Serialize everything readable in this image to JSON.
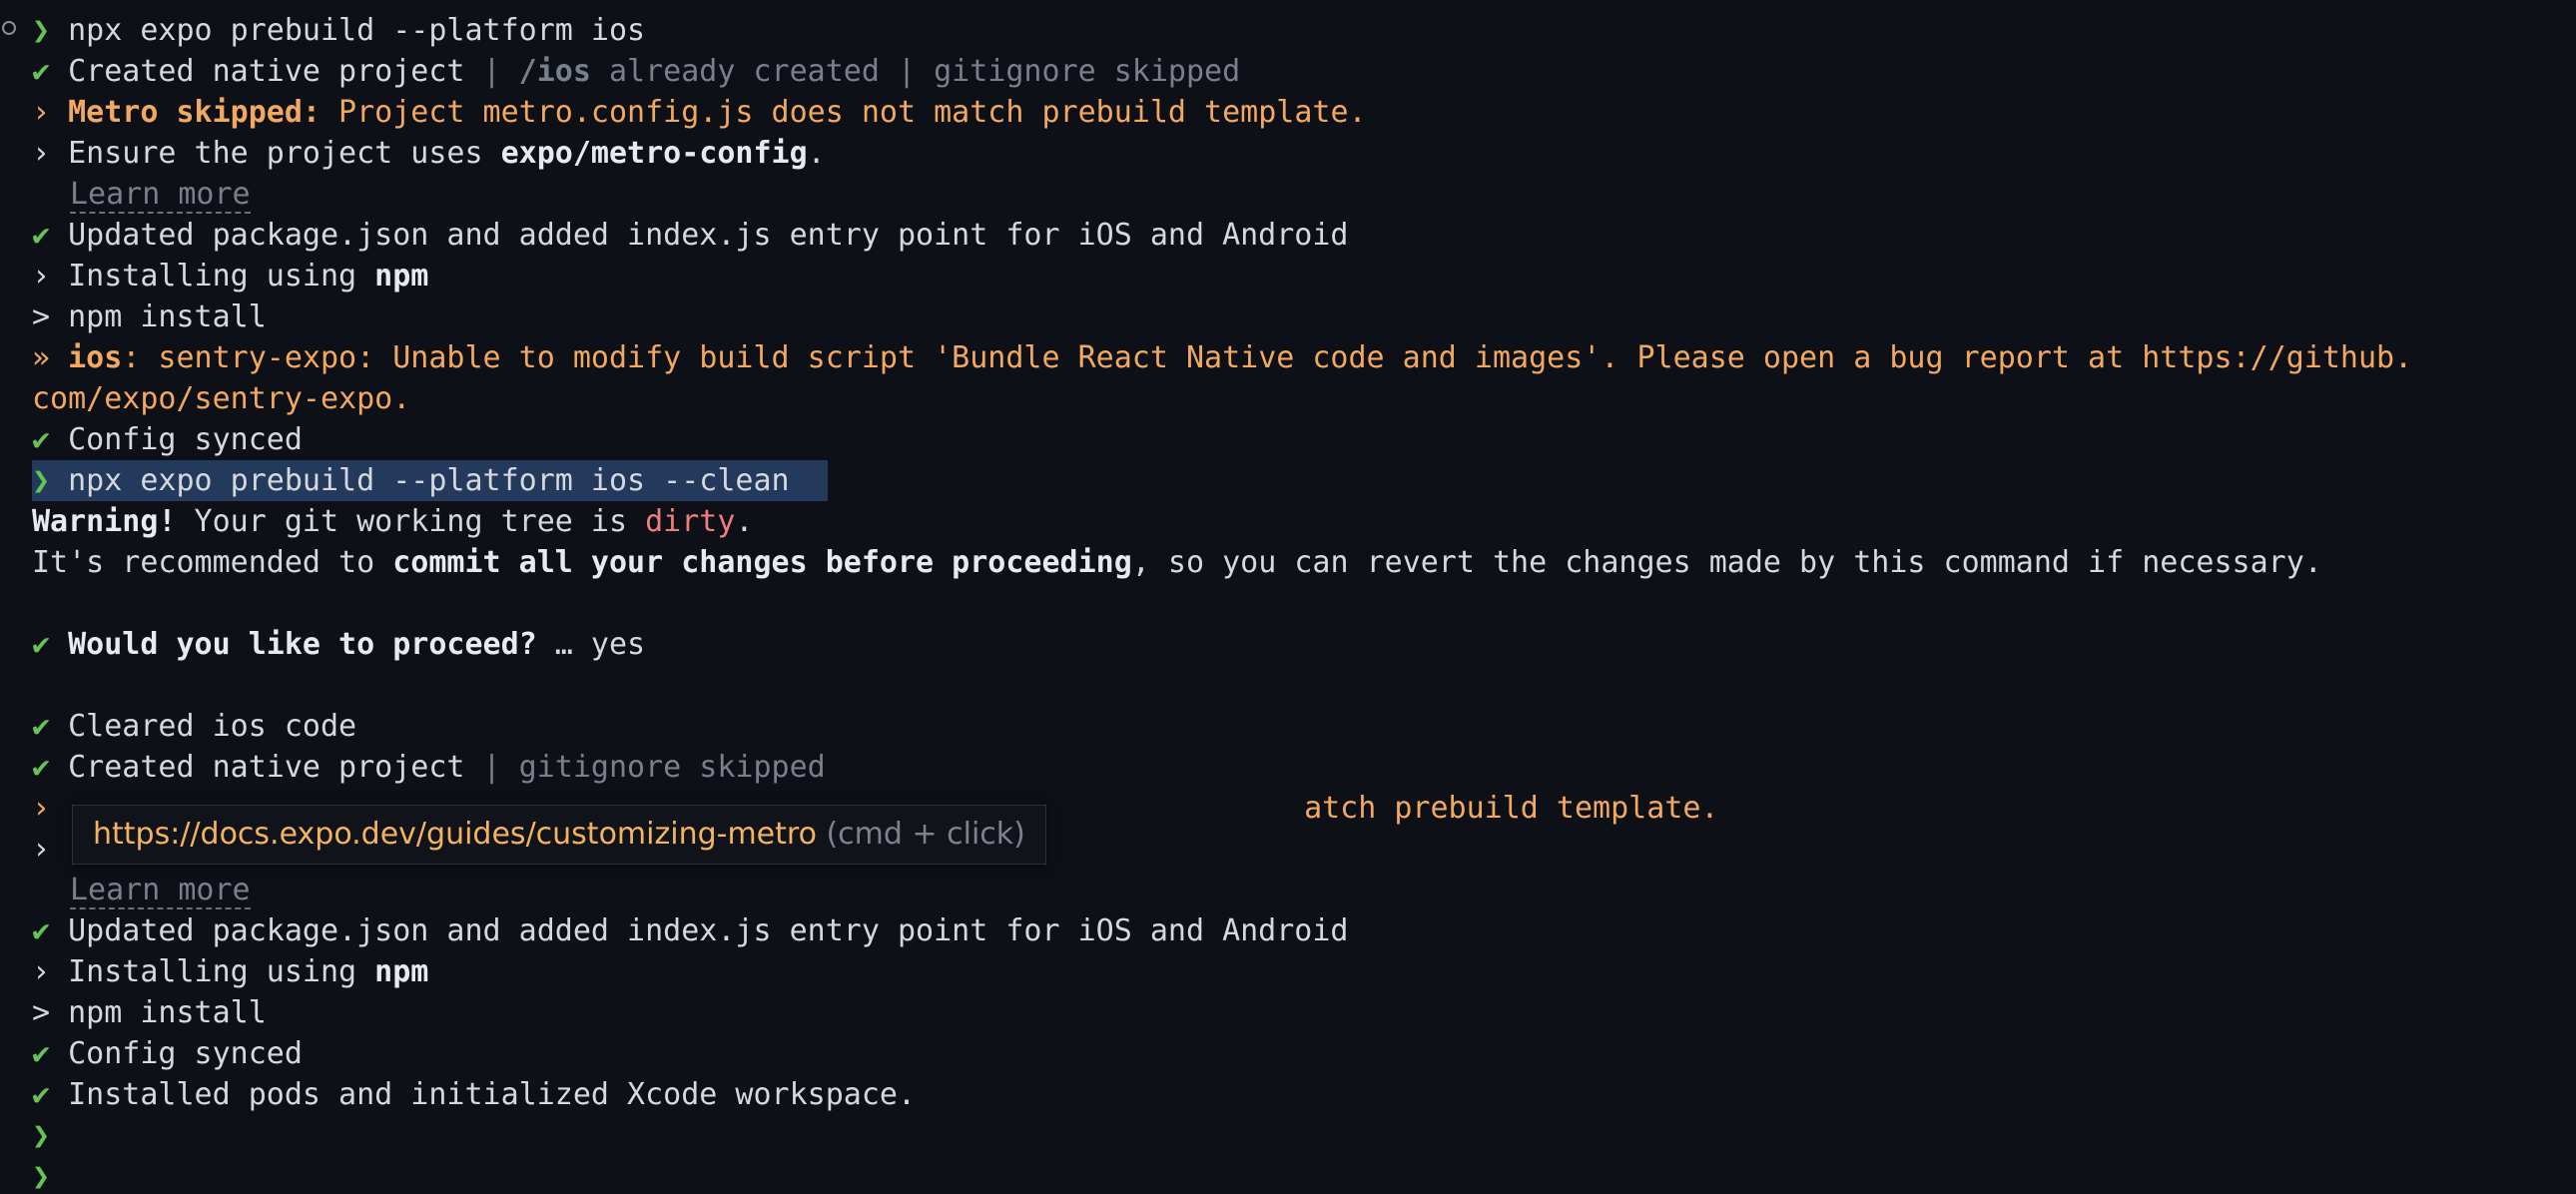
{
  "symbols": {
    "prompt": "❯",
    "check": "✔",
    "info": "›",
    "cmd": ">",
    "warn": "»"
  },
  "session1": {
    "command": "npx expo prebuild --platform ios",
    "created_a": "Created native project",
    "sep": " | ",
    "ios_dir": "/ios",
    "already_created": " already created",
    "gitignore_skipped": "gitignore skipped",
    "metro_label": "Metro skipped:",
    "metro_msg": " Project metro.config.js does not match prebuild template.",
    "ensure_pre": "Ensure the project uses ",
    "ensure_pkg": "expo/metro-config",
    "ensure_post": ".",
    "learn_more": "Learn more",
    "updated_pkg": "Updated package.json and added index.js entry point for iOS and Android",
    "installing_pre": "Installing using ",
    "installing_npm": "npm",
    "npm_install": "npm install",
    "ios_label": "ios",
    "sentry_msg": ": sentry-expo: Unable to modify build script 'Bundle React Native code and images'. Please open a bug report at https://github.",
    "sentry_wrap": "com/expo/sentry-expo.",
    "config_synced": "Config synced"
  },
  "session2": {
    "command": "npx expo prebuild --platform ios --clean",
    "warning_label": "Warning!",
    "warning_pre": " Your git working tree is ",
    "warning_dirty": "dirty",
    "warning_post": ".",
    "rec_pre": "It's recommended to ",
    "rec_bold": "commit all your changes before proceeding",
    "rec_post": ", so you can revert the changes made by this command if necessary.",
    "proceed_q": "Would you like to proceed?",
    "proceed_ans": " … yes",
    "cleared": "Cleared ios code",
    "created": "Created native project",
    "sep": " | ",
    "gitignore_skipped": "gitignore skipped",
    "metro_visible_tail": "atch prebuild template.",
    "learn_more": "Learn more",
    "updated_pkg": "Updated package.json and added index.js entry point for iOS and Android",
    "installing_pre": "Installing using ",
    "installing_npm": "npm",
    "npm_install": "npm install",
    "config_synced": "Config synced",
    "pods": "Installed pods and initialized Xcode workspace."
  },
  "tooltip": {
    "url": "https://docs.expo.dev/guides/customizing-metro",
    "hint": " (cmd + click)"
  }
}
